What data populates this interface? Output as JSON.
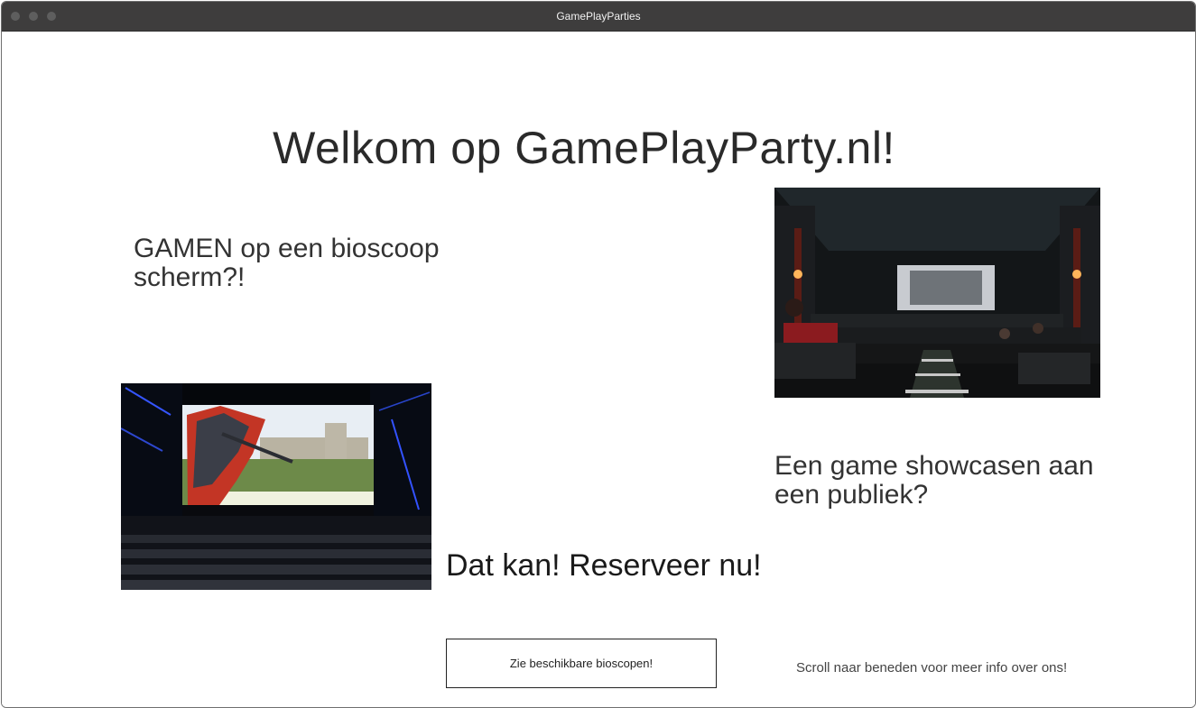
{
  "window": {
    "title": "GamePlayParties"
  },
  "page": {
    "title": "Welkom op GamePlayParty.nl!",
    "headline_left": "GAMEN op een bioscoop scherm?!",
    "headline_right": "Een game showcasen aan een publiek?",
    "cta_text": "Dat kan! Reserveer nu!",
    "button_label": "Zie beschikbare bioscopen!",
    "scroll_hint": "Scroll naar beneden voor meer info over ons!"
  },
  "images": {
    "right": {
      "name": "cinema-audience-image"
    },
    "left": {
      "name": "cinema-game-screen-image"
    }
  }
}
